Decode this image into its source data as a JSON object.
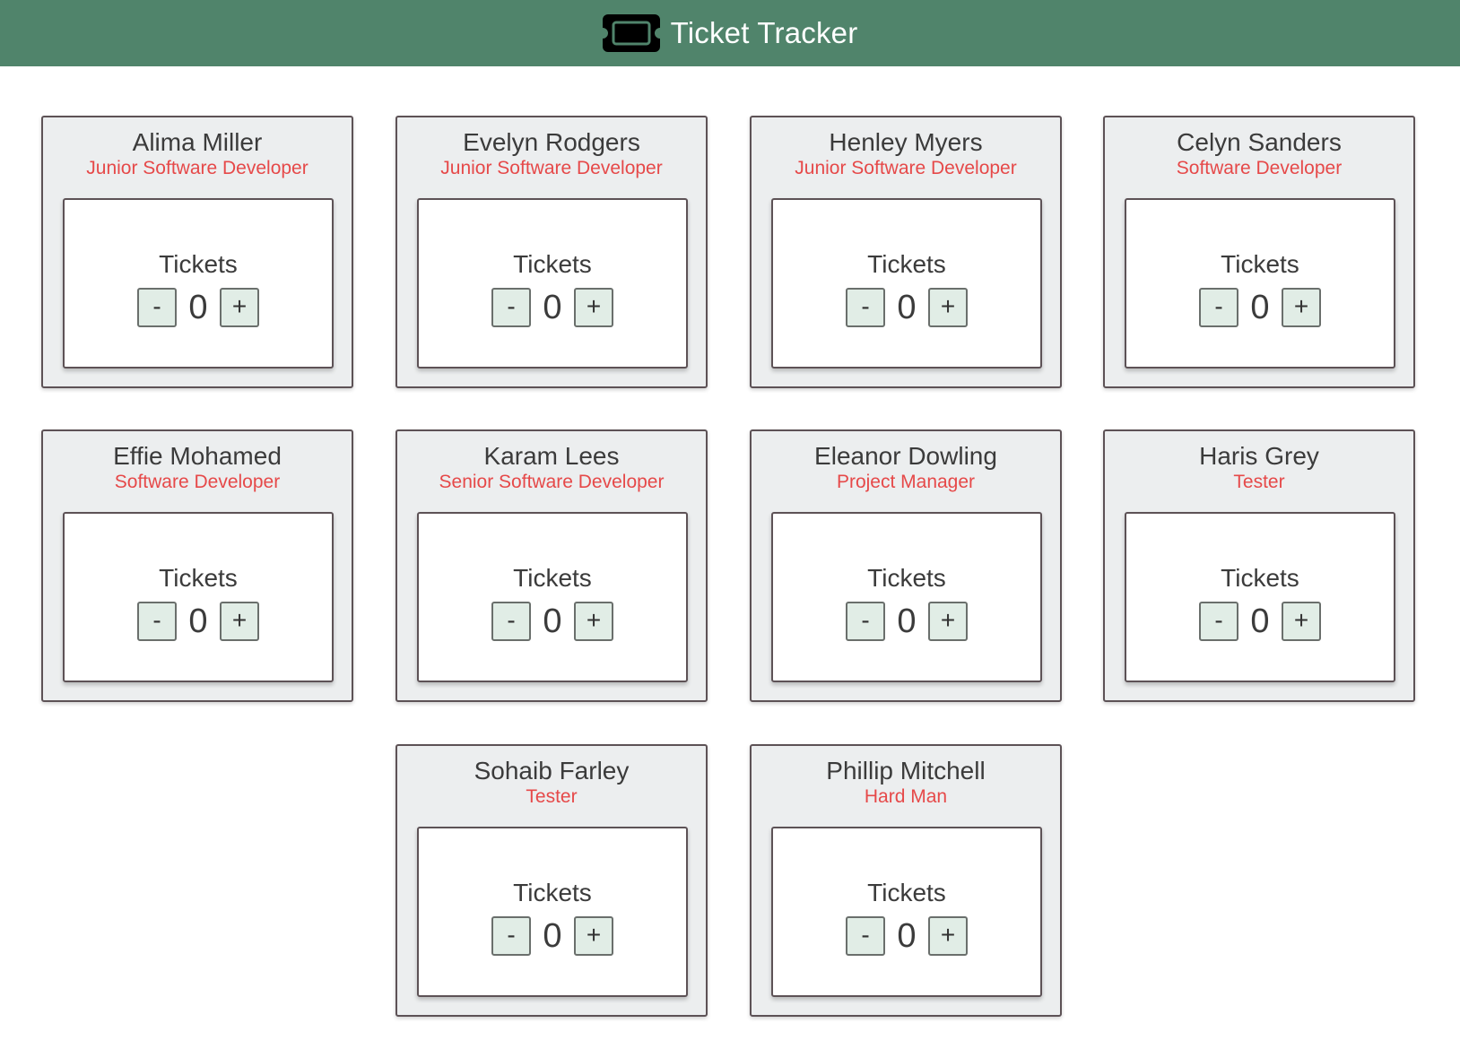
{
  "header": {
    "title": "Ticket Tracker",
    "icon": "ticket-icon",
    "background": "#50846b"
  },
  "colors": {
    "role_text": "#e64949",
    "button_bg": "#e1ede6"
  },
  "people": [
    {
      "name": "Alima Miller",
      "role": "Junior Software Developer",
      "tickets_label": "Tickets",
      "count": "0",
      "minus": "-",
      "plus": "+"
    },
    {
      "name": "Evelyn Rodgers",
      "role": "Junior Software Developer",
      "tickets_label": "Tickets",
      "count": "0",
      "minus": "-",
      "plus": "+"
    },
    {
      "name": "Henley Myers",
      "role": "Junior Software Developer",
      "tickets_label": "Tickets",
      "count": "0",
      "minus": "-",
      "plus": "+"
    },
    {
      "name": "Celyn Sanders",
      "role": "Software Developer",
      "tickets_label": "Tickets",
      "count": "0",
      "minus": "-",
      "plus": "+"
    },
    {
      "name": "Effie Mohamed",
      "role": "Software Developer",
      "tickets_label": "Tickets",
      "count": "0",
      "minus": "-",
      "plus": "+"
    },
    {
      "name": "Karam Lees",
      "role": "Senior Software Developer",
      "tickets_label": "Tickets",
      "count": "0",
      "minus": "-",
      "plus": "+"
    },
    {
      "name": "Eleanor Dowling",
      "role": "Project Manager",
      "tickets_label": "Tickets",
      "count": "0",
      "minus": "-",
      "plus": "+"
    },
    {
      "name": "Haris Grey",
      "role": "Tester",
      "tickets_label": "Tickets",
      "count": "0",
      "minus": "-",
      "plus": "+"
    },
    {
      "name": "Sohaib Farley",
      "role": "Tester",
      "tickets_label": "Tickets",
      "count": "0",
      "minus": "-",
      "plus": "+"
    },
    {
      "name": "Phillip Mitchell",
      "role": "Hard Man",
      "tickets_label": "Tickets",
      "count": "0",
      "minus": "-",
      "plus": "+"
    }
  ]
}
